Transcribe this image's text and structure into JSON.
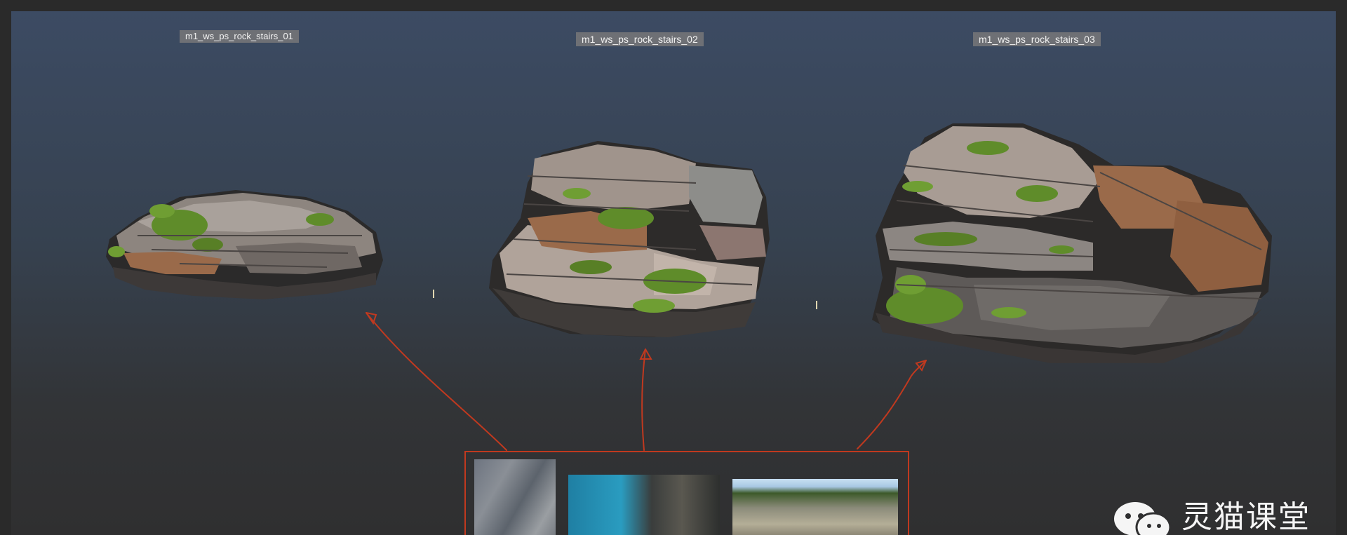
{
  "assets": [
    {
      "label": "m1_ws_ps_rock_stairs_01"
    },
    {
      "label": "m1_ws_ps_rock_stairs_02"
    },
    {
      "label": "m1_ws_ps_rock_stairs_03"
    }
  ],
  "colors": {
    "annotation_red": "#c0391f",
    "label_bg": "#6e7075",
    "moss_green": "#5f8c2a",
    "rock_gray": "#8c8580",
    "rock_rust": "#9a6a4a"
  },
  "icons": {
    "watermark": "wechat-icon",
    "pivot": "pivot-marker-icon"
  },
  "watermark": {
    "text": "灵猫课堂"
  }
}
